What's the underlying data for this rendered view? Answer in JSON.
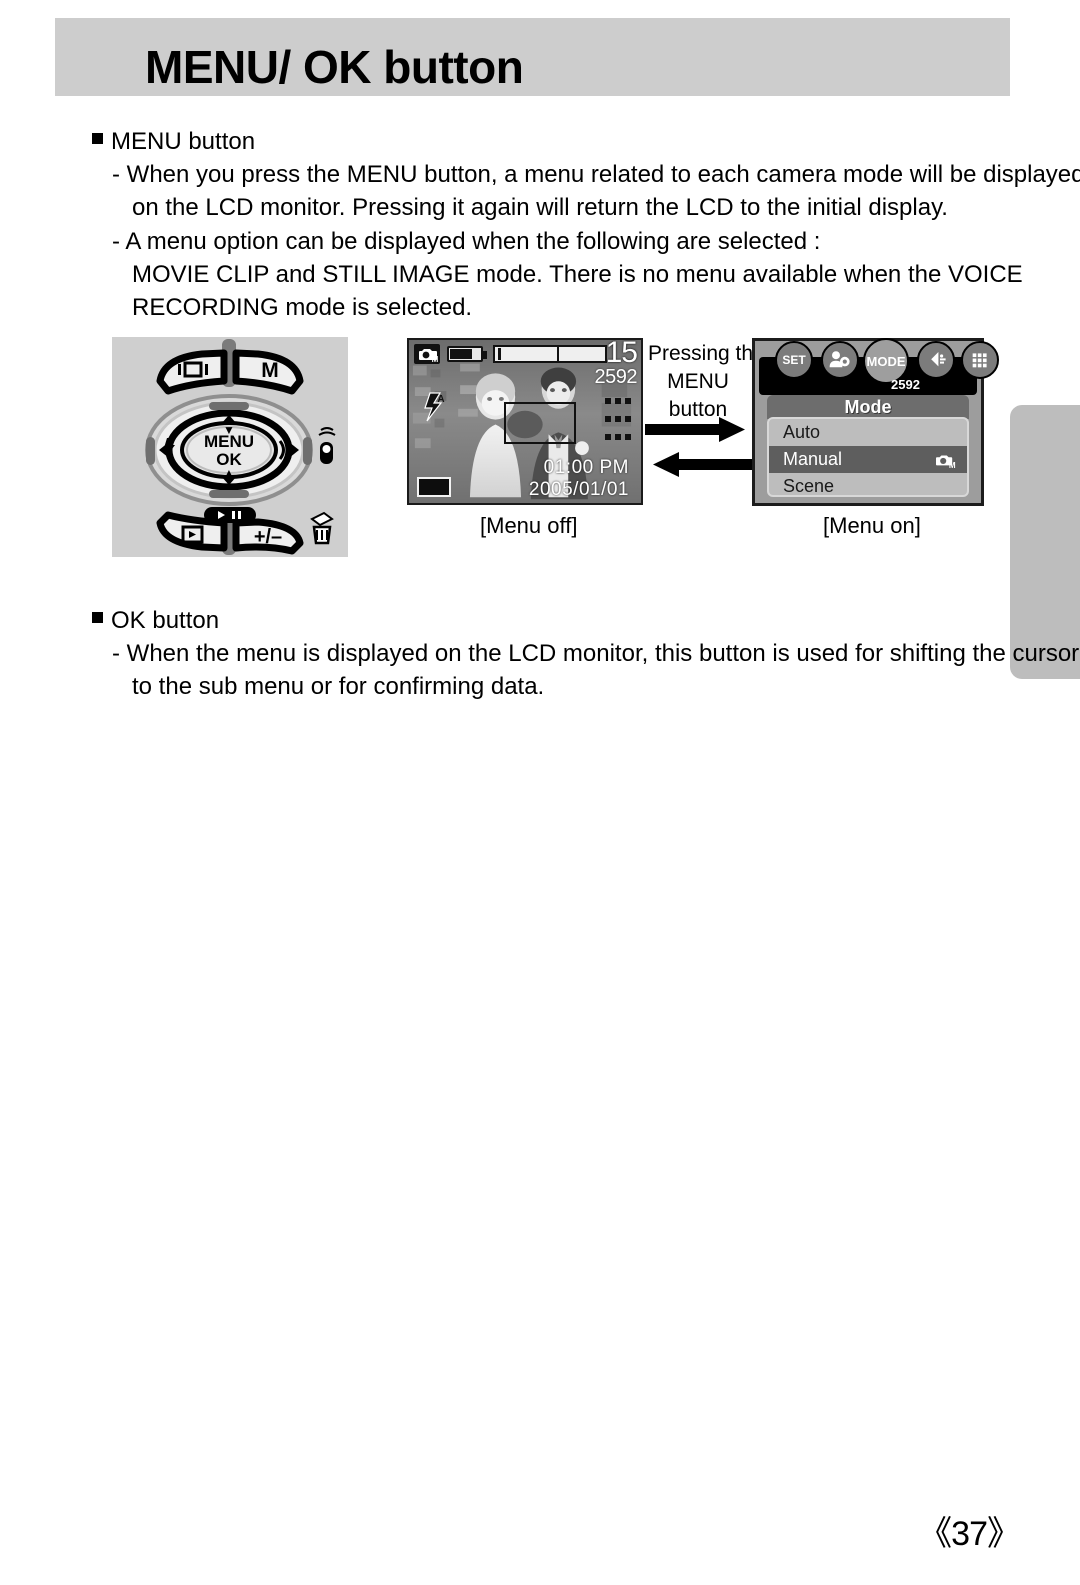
{
  "header": {
    "title": "MENU/ OK button"
  },
  "sections": [
    {
      "heading": "MENU button",
      "paragraphs": [
        [
          "When you press the MENU button, a menu related to each camera mode will be displayed",
          "on the LCD monitor. Pressing it again will return the LCD to the initial display."
        ],
        [
          "A menu option can be displayed when the following are selected :",
          "MOVIE CLIP and STILL IMAGE mode. There is no menu available when the VOICE",
          "RECORDING mode is selected."
        ]
      ]
    },
    {
      "heading": "OK button",
      "paragraphs": [
        [
          "When the menu is displayed on the LCD monitor, this button is used for shifting the cursor",
          "to the sub menu or for confirming data."
        ]
      ]
    }
  ],
  "camera_diagram": {
    "display_button_label": "display-icon",
    "m_button_label": "M",
    "center_button_line1": "MENU",
    "center_button_line2": "OK",
    "play_pause_label": "▶/Ⅱ",
    "playback_button_label": "playback-icon",
    "exposure_button_label": "+/–",
    "delete_icon_label": "delete-icon",
    "voice_icon_label": "voice-memo-icon"
  },
  "lcd_menu_off": {
    "mode_icon": "camera-manual-icon",
    "battery_icon": "battery-icon",
    "zoom_bar": "zoom-bar",
    "shots_remaining": "15",
    "resolution": "2592",
    "flash_icon": "flash-auto-icon",
    "quality_dots": "quality-indicator",
    "card_icon": "memory-card-icon",
    "time": "01:00 PM",
    "date": "2005/01/01",
    "caption": "[Menu off]"
  },
  "transition": {
    "lines": [
      "Pressing the",
      "MENU",
      "button"
    ],
    "forward_arrow": "arrow-right-icon",
    "back_arrow": "arrow-left-icon"
  },
  "lcd_menu_on": {
    "tabs": [
      {
        "label": "SET",
        "name": "tab-set",
        "selected": false
      },
      {
        "label": "",
        "name": "tab-setup",
        "selected": false
      },
      {
        "label": "MODE",
        "name": "tab-mode",
        "selected": true
      },
      {
        "label": "",
        "name": "tab-sound",
        "selected": false
      },
      {
        "label": "",
        "name": "tab-grid",
        "selected": false
      }
    ],
    "resolution": "2592",
    "panel_title": "Mode",
    "options": [
      {
        "label": "Auto",
        "selected": false,
        "icon": ""
      },
      {
        "label": "Manual",
        "selected": true,
        "icon": "camera-manual-icon"
      },
      {
        "label": "Scene",
        "selected": false,
        "icon": ""
      }
    ],
    "caption": "[Menu on]"
  },
  "footer": {
    "page_number": "《37》"
  },
  "colors": {
    "banner_bg": "#cdcdcd",
    "diagram_bg": "#cfcfcf",
    "panel_bg": "#9d9d9d",
    "panel_list_bg": "#bdbdbd",
    "panel_highlight": "#5e5e5e",
    "edge_tab": "#bdbdbd",
    "text": "#000000"
  }
}
